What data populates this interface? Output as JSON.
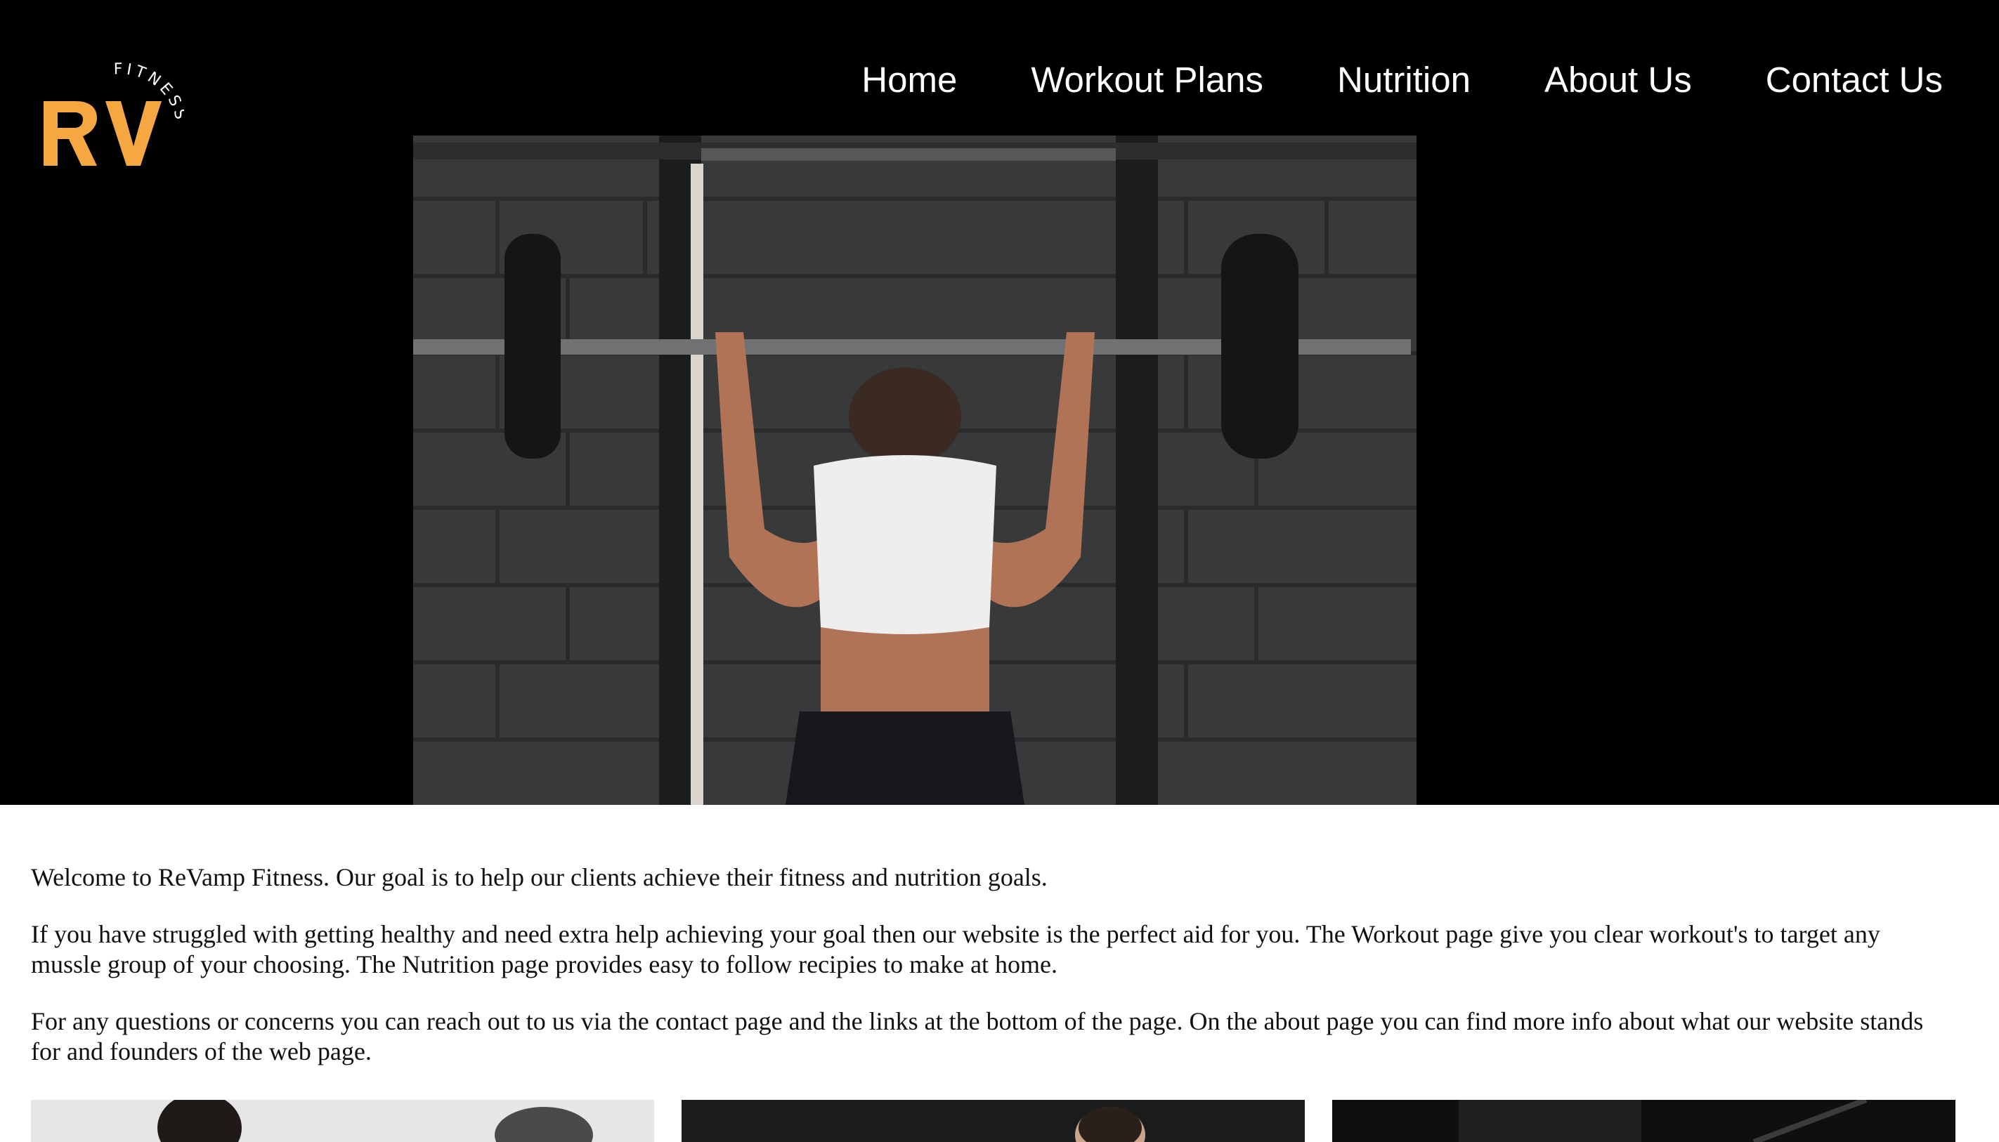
{
  "header": {
    "logo": {
      "letters": "RV",
      "arc_text": "FITNESS",
      "color": "#f5a742"
    },
    "nav": [
      {
        "label": "Home"
      },
      {
        "label": "Workout Plans"
      },
      {
        "label": "Nutrition"
      },
      {
        "label": "About Us"
      },
      {
        "label": "Contact Us"
      }
    ]
  },
  "hero": {
    "image_subject": "woman lifting barbell overhead in gym"
  },
  "content": {
    "paragraphs": [
      "Welcome to ReVamp Fitness. Our goal is to help our clients achieve their fitness and nutrition goals.",
      "If you have struggled with getting healthy and need extra help achieving your goal then our website is the perfect aid for you. The Workout page give you clear workout's to target any mussle group of your choosing. The Nutrition page provides easy to follow recipies to make at home.",
      "For any questions or concerns you can reach out to us via the contact page and the links at the bottom of the page. On the about page you can find more info about what our website stands for and founders of the web page."
    ]
  },
  "cards": [
    {
      "image_subject": "athlete photo"
    },
    {
      "image_subject": "athlete photo"
    },
    {
      "image_subject": "gym photo"
    }
  ],
  "colors": {
    "header_bg": "#000000",
    "accent": "#f5a742",
    "text": "#111111"
  }
}
